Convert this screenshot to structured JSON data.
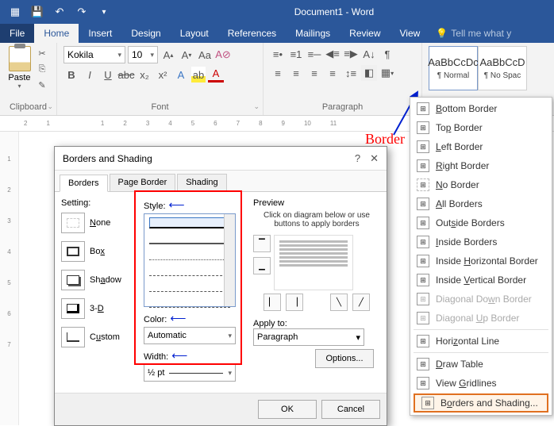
{
  "title": "Document1 - Word",
  "tabs": {
    "file": "File",
    "home": "Home",
    "insert": "Insert",
    "design": "Design",
    "layout": "Layout",
    "references": "References",
    "mailings": "Mailings",
    "review": "Review",
    "view": "View",
    "tell": "Tell me what y"
  },
  "ribbon": {
    "clipboard": {
      "paste": "Paste",
      "label": "Clipboard"
    },
    "font": {
      "name": "Kokila",
      "size": "10",
      "label": "Font"
    },
    "paragraph": {
      "label": "Paragraph"
    },
    "styles": {
      "sample": "AaBbCcDc",
      "sample2": "AaBbCcD",
      "normal": "¶ Normal",
      "nospace": "¶ No Spac"
    }
  },
  "ruler": {
    "marks": [
      "2",
      "1",
      "",
      "1",
      "2",
      "3",
      "4",
      "5",
      "6",
      "7",
      "8",
      "9",
      "10",
      "11"
    ]
  },
  "annotation": {
    "border": "Border"
  },
  "border_menu": {
    "items": [
      {
        "label": "Bottom Border",
        "u": "B"
      },
      {
        "label": "Top Border",
        "u": "P"
      },
      {
        "label": "Left Border",
        "u": "L"
      },
      {
        "label": "Right Border",
        "u": "R"
      },
      {
        "label": "No Border",
        "u": "N"
      },
      {
        "label": "All Borders",
        "u": "A"
      },
      {
        "label": "Outside Borders",
        "u": "S"
      },
      {
        "label": "Inside Borders",
        "u": "I"
      },
      {
        "label": "Inside Horizontal Border",
        "u": "H"
      },
      {
        "label": "Inside Vertical Border",
        "u": "V"
      },
      {
        "label": "Diagonal Down Border",
        "u": "W",
        "disabled": true
      },
      {
        "label": "Diagonal Up Border",
        "u": "U",
        "disabled": true
      },
      {
        "label": "Horizontal Line",
        "u": "Z",
        "sep_before": true
      },
      {
        "label": "Draw Table",
        "u": "D",
        "sep_before": true
      },
      {
        "label": "View Gridlines",
        "u": "G"
      },
      {
        "label": "Borders and Shading...",
        "u": "O",
        "selected": true
      }
    ]
  },
  "dialog": {
    "title": "Borders and Shading",
    "tabs": {
      "borders": "Borders",
      "page": "Page Border",
      "shading": "Shading"
    },
    "setting": {
      "label": "Setting:",
      "none": "None",
      "box": "Box",
      "shadow": "Shadow",
      "threeD": "3-D",
      "custom": "Custom"
    },
    "style": {
      "style_label": "Style:",
      "color_label": "Color:",
      "color_value": "Automatic",
      "width_label": "Width:",
      "width_value": "½ pt"
    },
    "preview": {
      "label": "Preview",
      "hint": "Click on diagram below or use buttons to apply borders",
      "apply_label": "Apply to:",
      "apply_value": "Paragraph",
      "options": "Options..."
    },
    "buttons": {
      "ok": "OK",
      "cancel": "Cancel"
    }
  }
}
